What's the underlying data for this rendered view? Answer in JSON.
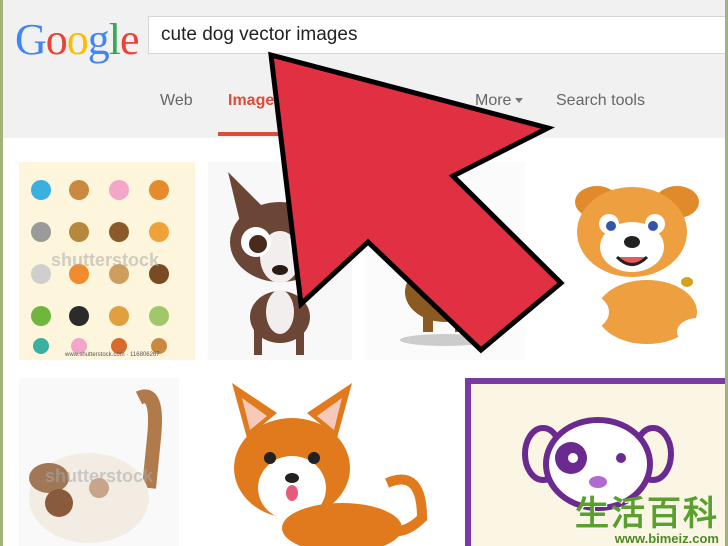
{
  "logo": {
    "text": "Google"
  },
  "search": {
    "query": "cute dog vector images"
  },
  "tabs": [
    {
      "label": "Web"
    },
    {
      "label": "Images"
    },
    {
      "label": "More"
    },
    {
      "label": "Search tools"
    }
  ],
  "results": {
    "watermark": "shutterstock",
    "caption": "www.shutterstock.com · 116806267"
  },
  "site_watermark": {
    "chinese": "生活百科",
    "url": "www.bimeiz.com"
  },
  "colors": {
    "google_red": "#dd4b39",
    "arrow": "#e03042"
  }
}
